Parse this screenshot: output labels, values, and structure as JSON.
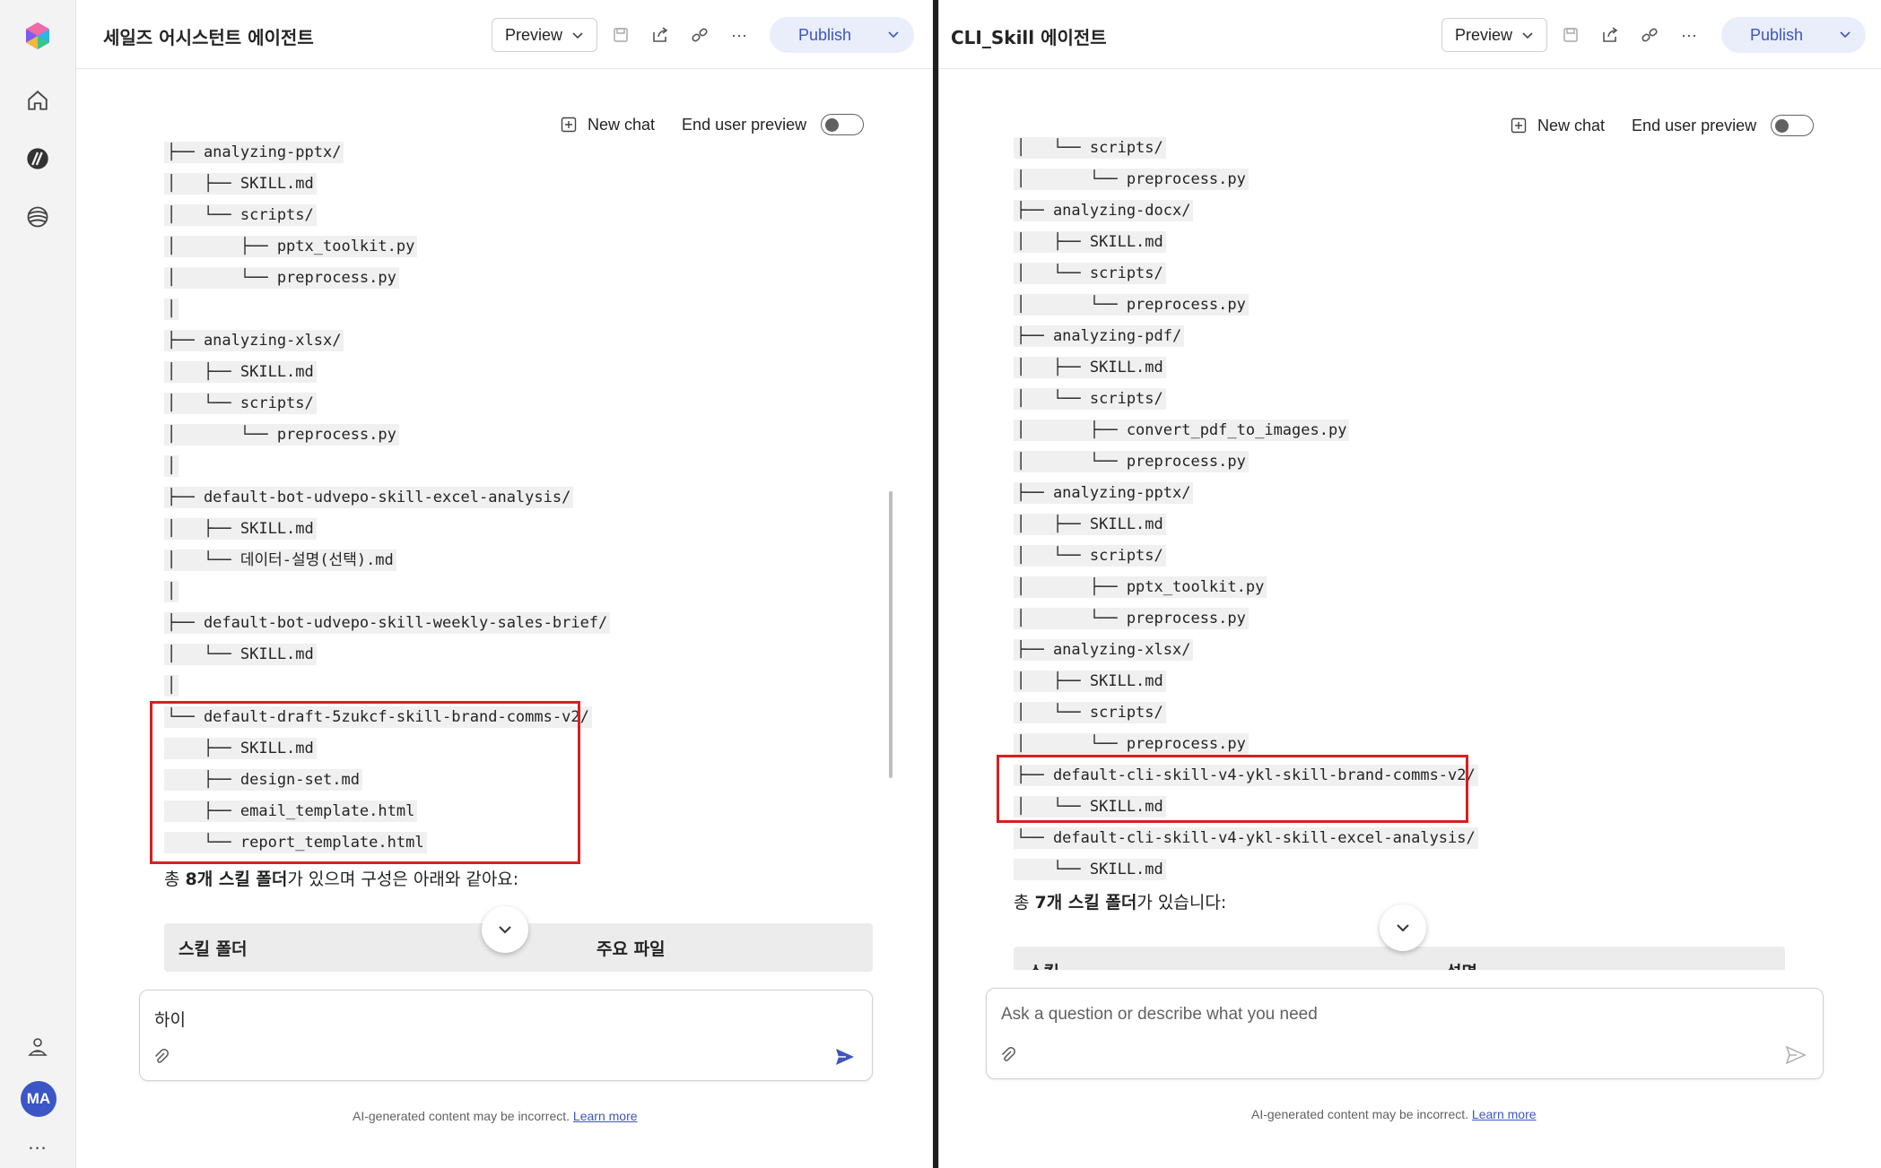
{
  "colors": {
    "accent": "#3d55c2",
    "highlight_box": "#d62020",
    "publish_bg": "#eaeefb"
  },
  "rail": {
    "icons": [
      "app-logo-icon",
      "home-icon",
      "agents-icon",
      "library-icon",
      "admin-icon"
    ],
    "avatar_initials": "MA",
    "more": "..."
  },
  "left_pane": {
    "title": "세일즈 어시스턴트 에이전트",
    "preview_label": "Preview",
    "publish_label": "Publish",
    "new_chat_label": "New chat",
    "end_user_preview_label": "End user preview",
    "tree_lines": [
      "├── analyzing-pptx/",
      "│   ├── SKILL.md",
      "│   └── scripts/",
      "│       ├── pptx_toolkit.py",
      "│       └── preprocess.py",
      "│",
      "├── analyzing-xlsx/",
      "│   ├── SKILL.md",
      "│   └── scripts/",
      "│       └── preprocess.py",
      "│",
      "├── default-bot-udvepo-skill-excel-analysis/",
      "│   ├── SKILL.md",
      "│   └── 데이터-설명(선택).md",
      "│",
      "├── default-bot-udvepo-skill-weekly-sales-brief/",
      "│   └── SKILL.md",
      "│",
      "└── default-draft-5zukcf-skill-brand-comms-v2/",
      "    ├── SKILL.md",
      "    ├── design-set.md",
      "    ├── email_template.html",
      "    └── report_template.html"
    ],
    "summary_prefix": "총 ",
    "summary_bold": "8개 스킬 폴더",
    "summary_suffix": "가 있으며 구성은 아래와 같아요:",
    "table_headers": [
      "스킬 폴더",
      "주요 파일"
    ],
    "composer_text": "하이",
    "disclaimer": "AI-generated content may be incorrect.",
    "learn_more": "Learn more"
  },
  "right_pane": {
    "title": "CLI_Skill 에이전트",
    "preview_label": "Preview",
    "publish_label": "Publish",
    "new_chat_label": "New chat",
    "end_user_preview_label": "End user preview",
    "tree_lines": [
      "│   └── scripts/",
      "│       └── preprocess.py",
      "├── analyzing-docx/",
      "│   ├── SKILL.md",
      "│   └── scripts/",
      "│       └── preprocess.py",
      "├── analyzing-pdf/",
      "│   ├── SKILL.md",
      "│   └── scripts/",
      "│       ├── convert_pdf_to_images.py",
      "│       └── preprocess.py",
      "├── analyzing-pptx/",
      "│   ├── SKILL.md",
      "│   └── scripts/",
      "│       ├── pptx_toolkit.py",
      "│       └── preprocess.py",
      "├── analyzing-xlsx/",
      "│   ├── SKILL.md",
      "│   └── scripts/",
      "│       └── preprocess.py",
      "├── default-cli-skill-v4-ykl-skill-brand-comms-v2/",
      "│   └── SKILL.md",
      "└── default-cli-skill-v4-ykl-skill-excel-analysis/",
      "    └── SKILL.md"
    ],
    "summary_prefix": "총 ",
    "summary_bold": "7개 스킬 폴더",
    "summary_suffix": "가 있습니다:",
    "table_headers": [
      "스킬",
      "설명"
    ],
    "composer_placeholder": "Ask a question or describe what you need",
    "disclaimer": "AI-generated content may be incorrect.",
    "learn_more": "Learn more"
  }
}
